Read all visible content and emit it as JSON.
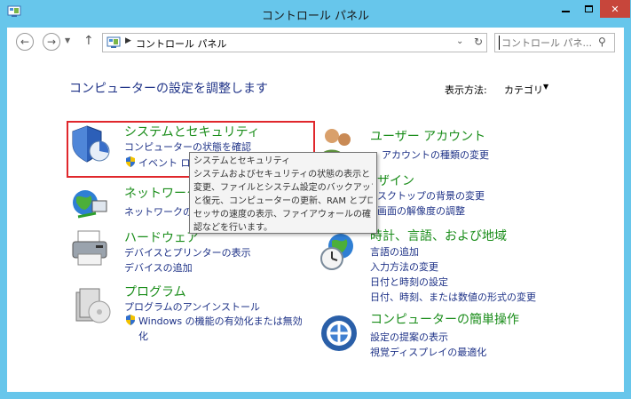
{
  "window": {
    "title": "コントロール パネル",
    "close_label": "✕"
  },
  "nav": {
    "address_text": "コントロール パネル",
    "search_placeholder": "コントロール パネ..."
  },
  "heading": "コンピューターの設定を調整します",
  "view_by": {
    "label": "表示方法:",
    "value": "カテゴリ"
  },
  "categories": {
    "system_security": {
      "title": "システムとセキュリティ",
      "links": [
        "コンピューターの状態を確認",
        "イベント ログ"
      ]
    },
    "network": {
      "title": "ネットワークと",
      "links": [
        "ネットワークの状"
      ]
    },
    "hardware": {
      "title": "ハードウェア",
      "links": [
        "デバイスとプリンターの表示",
        "デバイスの追加"
      ]
    },
    "programs": {
      "title": "プログラム",
      "links": [
        "プログラムのアンインストール",
        "Windows の機能の有効化または無効",
        "化"
      ]
    },
    "user_accounts": {
      "title": "ユーザー アカウント",
      "links": [
        "アカウントの種類の変更"
      ]
    },
    "appearance": {
      "title": "ザイン",
      "links": [
        "スクトップの背景の変更",
        "画面の解像度の調整"
      ]
    },
    "clock_region": {
      "title": "時計、言語、および地域",
      "links": [
        "言語の追加",
        "入力方法の変更",
        "日付と時刻の設定",
        "日付、時刻、または数値の形式の変更"
      ]
    },
    "ease_of_access": {
      "title": "コンピューターの簡単操作",
      "links": [
        "設定の提案の表示",
        "視覚ディスプレイの最適化"
      ]
    }
  },
  "tooltip": {
    "lines": [
      "システムとセキュリティ",
      "システムおよびセキュリティの状態の表示と",
      "変更、ファイルとシステム設定のバックアップ",
      "と復元、コンピューターの更新、RAM とプロ",
      "セッサの速度の表示、ファイアウォールの確",
      "認などを行います。"
    ]
  },
  "colors": {
    "window_frame": "#67c6eb",
    "heading": "#1e3287",
    "category_title": "#1a8d1a",
    "link": "#1e3287",
    "highlight_border": "#e0272c"
  }
}
